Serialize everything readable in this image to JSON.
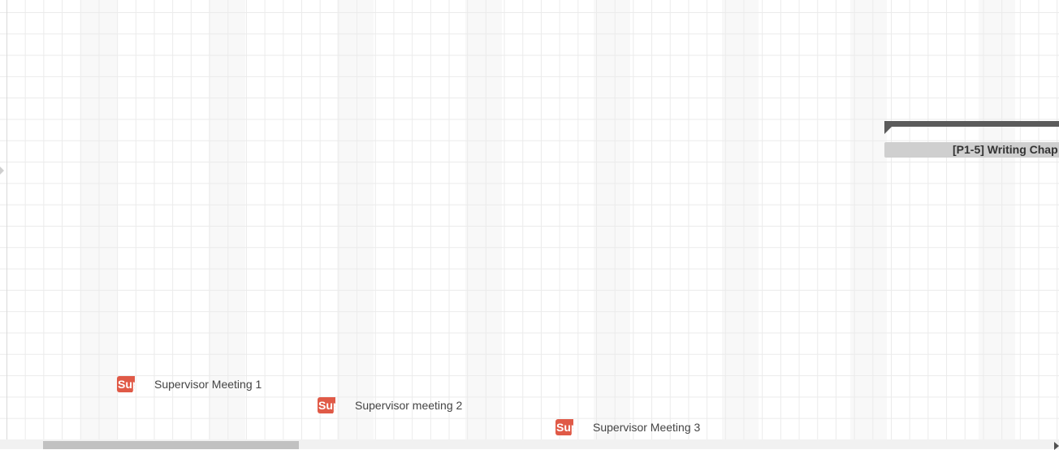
{
  "summary_task": {
    "label": "[P1-5] Writing Chap"
  },
  "milestones": [
    {
      "badge": "Sup",
      "label": "Supervisor Meeting 1"
    },
    {
      "badge": "Sup",
      "label": "Supervisor meeting 2"
    },
    {
      "badge": "Sup",
      "label": "Supervisor Meeting 3"
    }
  ],
  "colors": {
    "milestone": "#e05a47",
    "summary_bar": "#5b5b5b",
    "summary_label_bg": "#cfcfcf",
    "grid": "#ebebeb"
  }
}
